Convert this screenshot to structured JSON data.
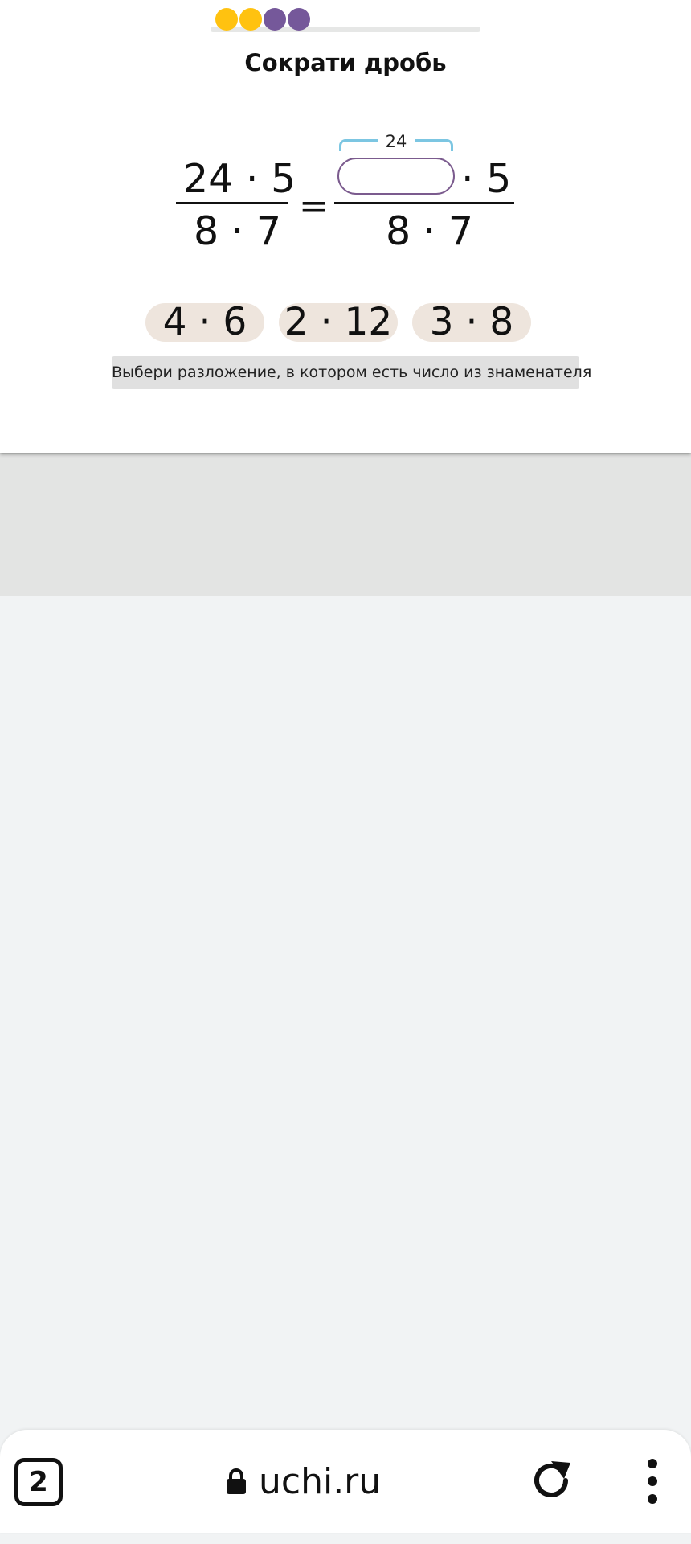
{
  "progress": {
    "completed": 2,
    "total": 4,
    "colors": [
      "#ffc210",
      "#ffc210",
      "#75589a",
      "#75589a"
    ]
  },
  "title": "Сократи дробь",
  "equation": {
    "left_numerator": "24 · 5",
    "left_denominator": "8 · 7",
    "equals": "=",
    "right_numerator_suffix": "· 5",
    "right_denominator": "8 · 7",
    "bracket_label": "24"
  },
  "options": [
    "4 · 6",
    "2 · 12",
    "3 · 8"
  ],
  "hint": "Выбери разложение, в котором есть число из знаменателя",
  "browser": {
    "tab_count": "2",
    "url": "uchi.ru",
    "icons": {
      "lock": "lock-icon",
      "reload": "reload-icon",
      "menu": "more-vertical-icon"
    }
  }
}
